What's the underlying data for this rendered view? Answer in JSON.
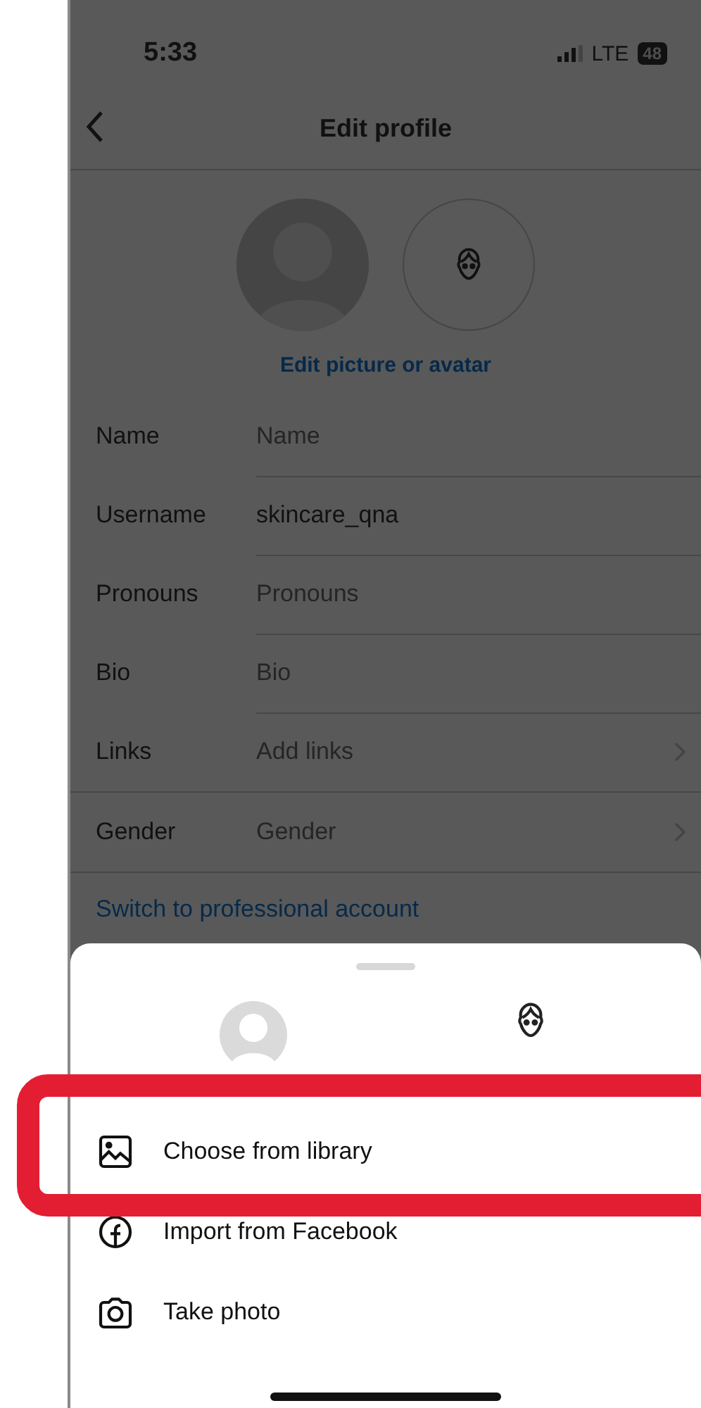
{
  "status_bar": {
    "time": "5:33",
    "network": "LTE",
    "battery": "48"
  },
  "header": {
    "title": "Edit profile"
  },
  "edit_picture_link": "Edit picture or avatar",
  "fields": [
    {
      "label": "Name",
      "placeholder": "Name",
      "chevron": false
    },
    {
      "label": "Username",
      "value": "skincare_qna",
      "chevron": false
    },
    {
      "label": "Pronouns",
      "placeholder": "Pronouns",
      "chevron": false
    },
    {
      "label": "Bio",
      "placeholder": "Bio",
      "chevron": false
    },
    {
      "label": "Links",
      "placeholder": "Add links",
      "chevron": true
    },
    {
      "label": "Gender",
      "placeholder": "Gender",
      "chevron": true
    }
  ],
  "professional_link": "Switch to professional account",
  "sheet": {
    "options": [
      {
        "kind": "library",
        "label": "Choose from library"
      },
      {
        "kind": "facebook",
        "label": "Import from Facebook"
      },
      {
        "kind": "camera",
        "label": "Take photo"
      }
    ]
  }
}
